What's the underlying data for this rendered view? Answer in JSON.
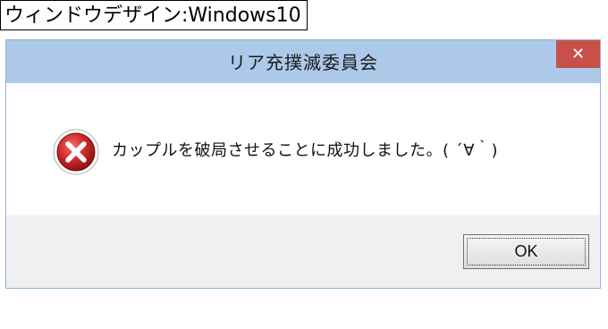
{
  "caption": "ウィンドウデザイン:Windows10",
  "dialog": {
    "title": "リア充撲滅委員会",
    "close_glyph": "✕",
    "message": "カップルを破局させることに成功しました。( ´∀｀)",
    "icon": "error-icon",
    "ok_label": "OK"
  },
  "colors": {
    "titlebar": "#acc9ea",
    "close": "#c7514a",
    "error": "#d12a2a",
    "footer": "#f0f0f0"
  }
}
